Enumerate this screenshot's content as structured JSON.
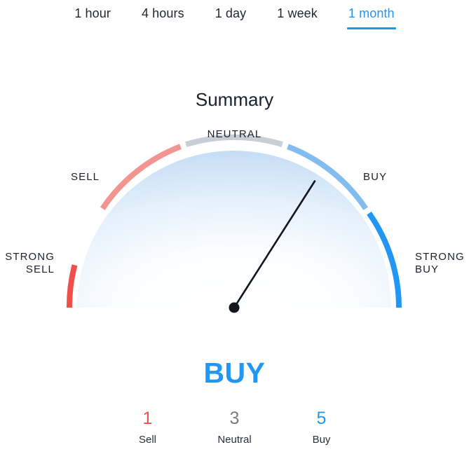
{
  "tabs": {
    "items": [
      {
        "label": "1 hour",
        "active": false
      },
      {
        "label": "4 hours",
        "active": false
      },
      {
        "label": "1 day",
        "active": false
      },
      {
        "label": "1 week",
        "active": false
      },
      {
        "label": "1 month",
        "active": true
      }
    ],
    "active_color": "#2196f3"
  },
  "title": "Summary",
  "gauge": {
    "labels": {
      "strong_sell": "STRONG\nSELL",
      "sell": "SELL",
      "neutral": "NEUTRAL",
      "buy": "BUY",
      "strong_buy": "STRONG\nBUY"
    },
    "segments": [
      {
        "name": "strong-sell",
        "color": "#ef4f4b",
        "start_deg": 180,
        "end_deg": 145
      },
      {
        "name": "sell",
        "color": "#f29490",
        "start_deg": 143,
        "end_deg": 109
      },
      {
        "name": "neutral",
        "color": "#c9cdd4",
        "start_deg": 107,
        "end_deg": 73
      },
      {
        "name": "buy",
        "color": "#83bdf0",
        "start_deg": 71,
        "end_deg": 37
      },
      {
        "name": "strong-buy",
        "color": "#2196f3",
        "start_deg": 35,
        "end_deg": 0
      }
    ],
    "needle_angle_deg": 57.5,
    "fill_color": "#cfe4f7"
  },
  "verdict": {
    "text": "BUY",
    "color": "#2196f3"
  },
  "counts": [
    {
      "value": "1",
      "label": "Sell",
      "color": "#f2514e"
    },
    {
      "value": "3",
      "label": "Neutral",
      "color": "#787b86"
    },
    {
      "value": "5",
      "label": "Buy",
      "color": "#2196f3"
    }
  ]
}
